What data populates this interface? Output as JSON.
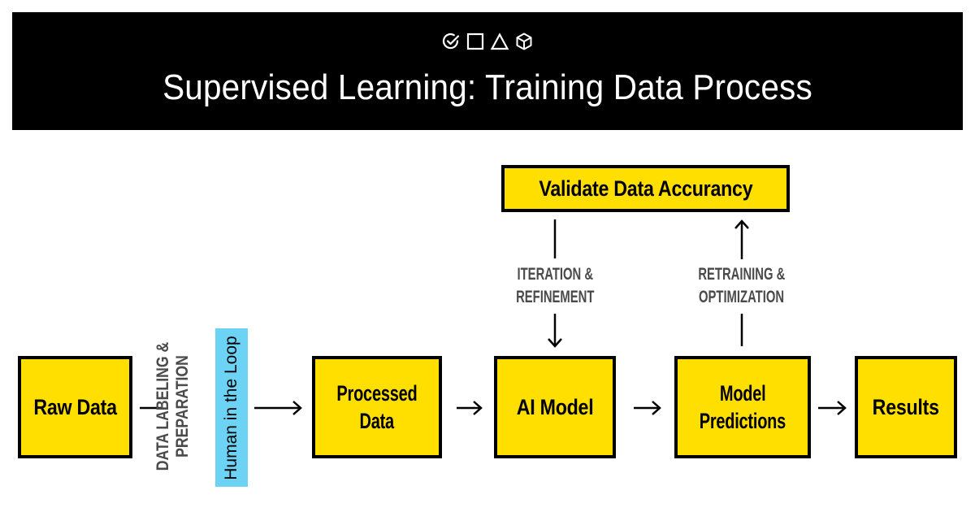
{
  "header": {
    "icons": [
      "check-circle-icon",
      "square-icon",
      "triangle-icon",
      "cube-icon"
    ],
    "title": "Supervised Learning: Training Data Process"
  },
  "nodes": {
    "raw_data": "Raw Data",
    "processed_data_line1": "Processed",
    "processed_data_line2": "Data",
    "ai_model": "AI Model",
    "model_predictions_line1": "Model",
    "model_predictions_line2": "Predictions",
    "results": "Results",
    "validate": "Validate Data Accurancy"
  },
  "edge_labels": {
    "labeling_line1": "DATA LABELING &",
    "labeling_line2": "PREPARATION",
    "human_in_loop": "Human in the Loop",
    "iteration_line1": "ITERATION &",
    "iteration_line2": "REFINEMENT",
    "retraining_line1": "RETRAINING &",
    "retraining_line2": "OPTIMIZATION"
  },
  "colors": {
    "box_fill": "#ffdf00",
    "header_bg": "#000000",
    "highlight": "#6dd3f5",
    "label_text": "#4a4a4a"
  }
}
